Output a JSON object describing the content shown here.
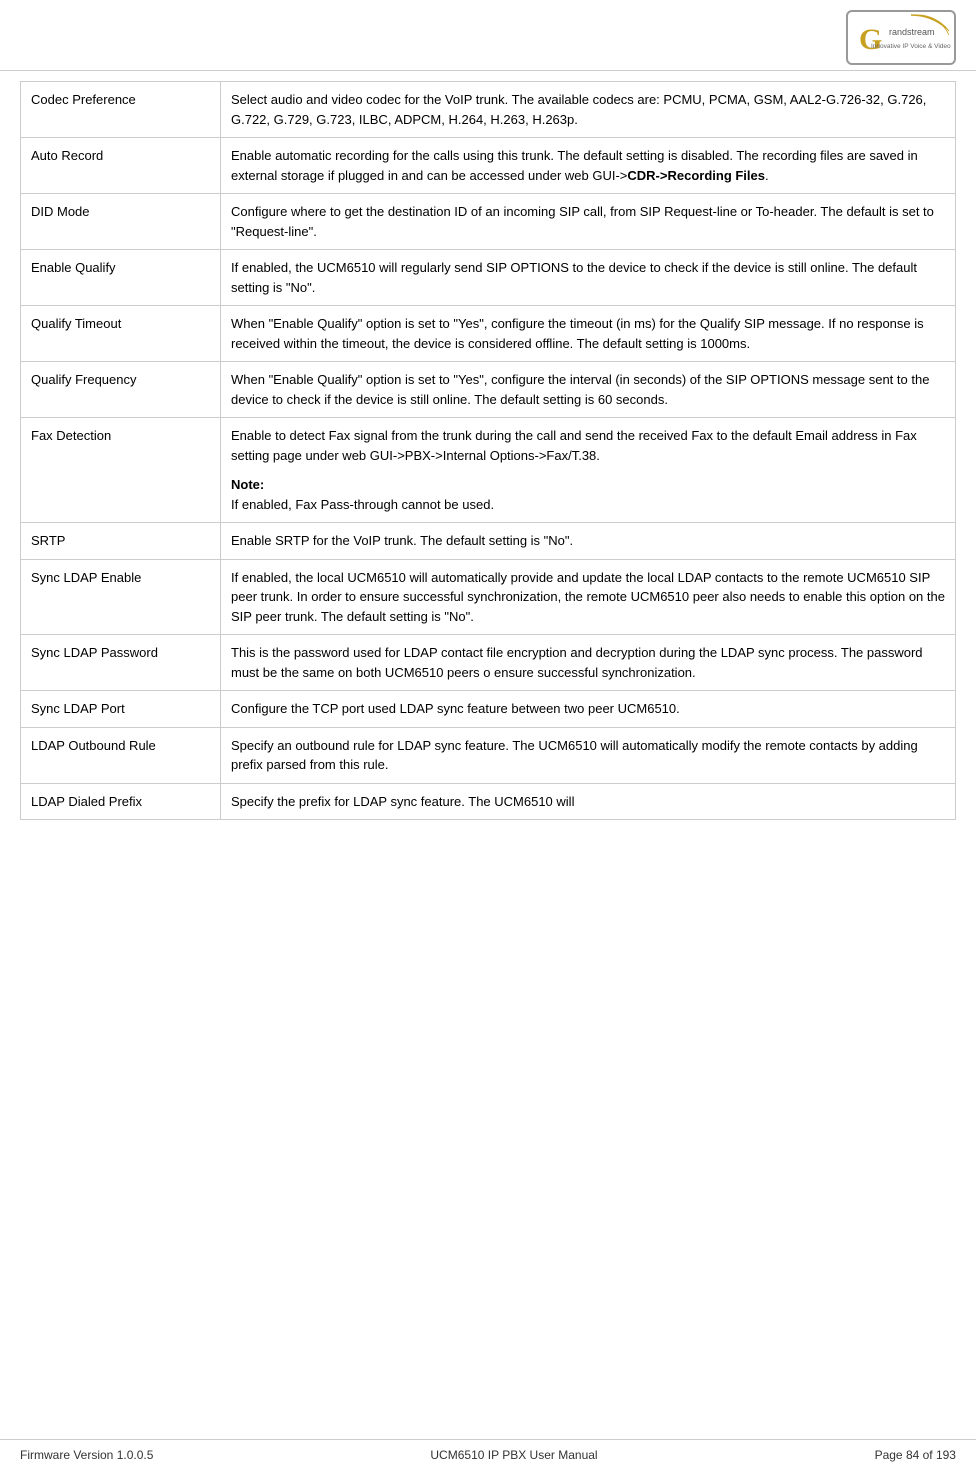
{
  "header": {
    "logo_g": "G",
    "logo_subtitle": "Innovative IP Voice & Video"
  },
  "footer": {
    "left": "Firmware Version 1.0.0.5",
    "center": "UCM6510 IP PBX User Manual",
    "right": "Page 84 of 193"
  },
  "rows": [
    {
      "label": "Codec Preference",
      "description": "Select audio and video codec for the VoIP trunk. The available codecs are:  PCMU,  PCMA,  GSM,  AAL2-G.726-32,  G.726,  G.722,  G.729, G.723, ILBC, ADPCM, H.264, H.263, H.263p."
    },
    {
      "label": "Auto Record",
      "description_parts": [
        {
          "text": "Enable  automatic  recording  for  the  calls  using  this  trunk.  The  default setting is disabled. The recording files are saved in external storage if plugged  in  and  can  be  accessed  under  web  GUI->",
          "bold": false
        },
        {
          "text": "CDR->Recording Files",
          "bold": true
        },
        {
          "text": ".",
          "bold": false
        }
      ]
    },
    {
      "label": "DID Mode",
      "description": "Configure where to get the destination ID of an incoming SIP call, from SIP Request-line or To-header. The default is set to \"Request-line\"."
    },
    {
      "label": "Enable Qualify",
      "description": "If enabled, the UCM6510 will regularly send SIP OPTIONS to the device to check if the device is still online. The default setting is \"No\"."
    },
    {
      "label": "Qualify Timeout",
      "description": "When \"Enable Qualify\" option is set to \"Yes\", configure the timeout (in ms) for the Qualify SIP message. If no response is received within the timeout, the device is considered offline. The default setting is 1000ms."
    },
    {
      "label": "Qualify Frequency",
      "description": "When \"Enable Qualify\" option is set to \"Yes\", configure the interval (in seconds) of the SIP OPTIONS message sent to the device to check if the device is still online. The default setting is 60 seconds."
    },
    {
      "label": "Fax Detection",
      "description_main": "Enable to detect Fax signal from the trunk during the call and send the received Fax to the default Email address in Fax setting page under web GUI->PBX->Internal Options->Fax/T.38.",
      "note_label": "Note:",
      "note_text": "If enabled, Fax Pass-through cannot be used."
    },
    {
      "label": "SRTP",
      "description": "Enable SRTP for the VoIP trunk. The default setting is \"No\"."
    },
    {
      "label": "Sync LDAP Enable",
      "description": "If enabled, the local UCM6510 will automatically provide and update the local LDAP contacts to the remote UCM6510 SIP peer trunk. In order to ensure  successful  synchronization,  the  remote  UCM6510  peer  also needs to enable this option on the SIP peer trunk. The default setting is \"No\"."
    },
    {
      "label": "Sync LDAP Password",
      "description": "This  is  the  password  used  for  LDAP  contact  file  encryption  and decryption during the LDAP sync process. The password must be the same on both UCM6510 peers o ensure successful synchronization."
    },
    {
      "label": "Sync LDAP Port",
      "description": "Configure  the  TCP  port  used  LDAP  sync  feature  between  two  peer UCM6510."
    },
    {
      "label": "LDAP Outbound Rule",
      "description": "Specify  an  outbound  rule  for  LDAP  sync  feature.  The  UCM6510  will automatically modify the remote contacts by adding prefix parsed from this rule."
    },
    {
      "label": "LDAP Dialed Prefix",
      "description": "Specify   the   prefix   for   LDAP   sync   feature.   The   UCM6510   will"
    }
  ]
}
